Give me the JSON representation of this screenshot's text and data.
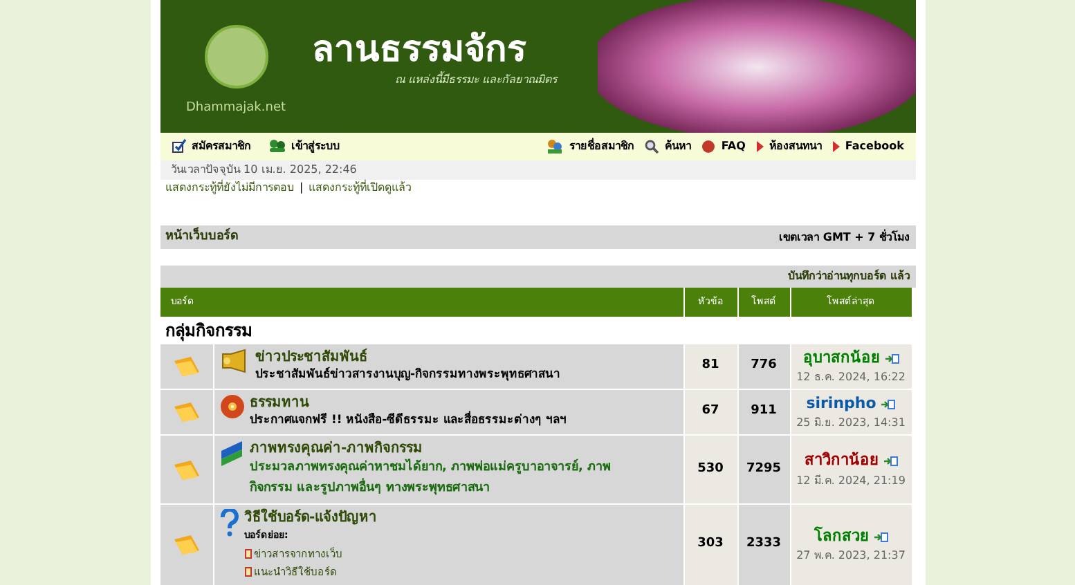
{
  "header": {
    "site_title": "ลานธรรมจักร",
    "tagline": "ณ แหล่งนี้มีธรรมะ และกัลยาณมิตร",
    "logo_caption": "Dhammajak.net"
  },
  "nav_left": [
    {
      "label": "สมัครสมาชิก",
      "kind": "register"
    },
    {
      "label": "เข้าสู่ระบบ",
      "kind": "login"
    }
  ],
  "nav_right": [
    {
      "label": "รายชื่อสมาชิก",
      "kind": "members"
    },
    {
      "label": "ค้นหา",
      "kind": "search"
    },
    {
      "label": "FAQ",
      "kind": "faq"
    },
    {
      "label": "ห้องสนทนา",
      "kind": "bullet"
    },
    {
      "label": "Facebook",
      "kind": "bullet"
    }
  ],
  "current_time": "วันเวลาปัจจุบัน 10 เม.ย. 2025, 22:46",
  "topic_links": [
    "แสดงกระทู้ที่ยังไม่มีการตอบ",
    "แสดงกระทู้ที่เปิดดูแล้ว"
  ],
  "topic_links_separator": "|",
  "breadcrumb": {
    "label": "หน้าเว็บบอร์ด",
    "timezone": "เขตเวลา GMT + 7 ชั่วโมง"
  },
  "mark_read": "บันทึกว่าอ่านทุกบอร์ด แล้ว",
  "table": {
    "columns": [
      "บอร์ด",
      "หัวข้อ",
      "โพสต์",
      "โพสต์ล่าสุด"
    ],
    "category": "กลุ่มกิจกรรม",
    "rows": [
      {
        "kind": "trumpet",
        "title": "ข่าวประชาสัมพันธ์",
        "description": "ประชาสัมพันธ์ข่าวสารงานบุญ-กิจกรรมทางพระพุทธศาสนา",
        "description_highlighted": false,
        "topics": "81",
        "posts": "776",
        "last_user": "อุบาสกน้อย",
        "color": "#008000",
        "last_time": "12 ธ.ค. 2024, 16:22"
      },
      {
        "kind": "disc",
        "title": "ธรรมทาน",
        "description": "ประกาศแจกฟรี !! หนังสือ-ซีดีธรรมะ และสื่อธรรมะต่างๆ ฯลฯ",
        "description_highlighted": false,
        "topics": "67",
        "posts": "911",
        "last_user": "sirinpho",
        "color": "#0a5aa8",
        "last_time": "25 มิ.ย. 2023, 14:31"
      },
      {
        "kind": "flag",
        "title": "ภาพทรงคุณค่า-ภาพกิจกรรม",
        "description": "ประมวลภาพทรงคุณค่าหาชมได้ยาก, ภาพพ่อแม่ครูบาอาจารย์, ภาพกิจกรรม และรูปภาพอื่นๆ ทางพระพุทธศาสนา",
        "description_highlighted": true,
        "topics": "530",
        "posts": "7295",
        "last_user": "สาวิกาน้อย",
        "color": "#a00000",
        "last_time": "12 มี.ค. 2024, 21:19"
      },
      {
        "kind": "question",
        "title": "วิธีใช้บอร์ด-แจ้งปัญหา",
        "subforums_label": "บอร์ดย่อย:",
        "subforums": [
          "ข่าวสารจากทางเว็บ",
          "แนะนำวิธีใช้บอร์ด"
        ],
        "topics": "303",
        "posts": "2333",
        "last_user": "โลกสวย",
        "color": "#008000",
        "last_time": "27 พ.ค. 2023, 21:37"
      }
    ]
  }
}
